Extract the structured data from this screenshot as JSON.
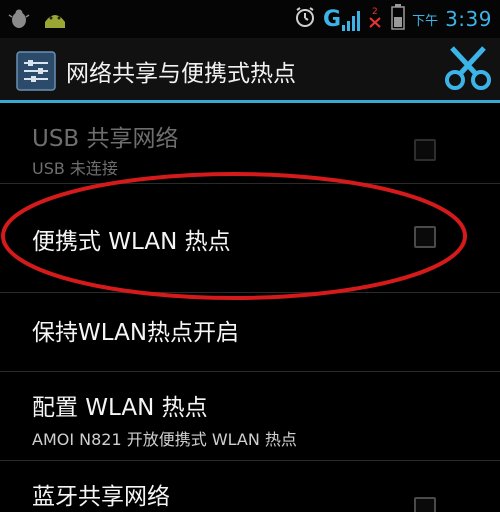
{
  "statusbar": {
    "icons": [
      "bug-icon",
      "android-icon",
      "alarm-clock-icon",
      "signal-g-icon",
      "missed-call-icon",
      "battery-icon"
    ],
    "signal_label": "G",
    "ampm": "下午",
    "time": "3:39"
  },
  "actionbar": {
    "title": "网络共享与便携式热点",
    "settings_icon": "settings-sliders-icon",
    "tool_icon": "scissors-icon"
  },
  "rows": [
    {
      "title": "USB 共享网络",
      "subtitle": "USB 未连接",
      "checked": false,
      "enabled": false
    },
    {
      "title": "便携式 WLAN 热点",
      "checked": false,
      "enabled": true
    },
    {
      "title": "保持WLAN热点开启",
      "enabled": true
    },
    {
      "title": "配置 WLAN 热点",
      "subtitle": "AMOI N821 开放便携式 WLAN 热点",
      "enabled": true
    },
    {
      "title": "蓝牙共享网络",
      "checked": false,
      "enabled": true
    }
  ],
  "colors": {
    "accent": "#36a9d8",
    "annotation": "#d41a1a"
  }
}
